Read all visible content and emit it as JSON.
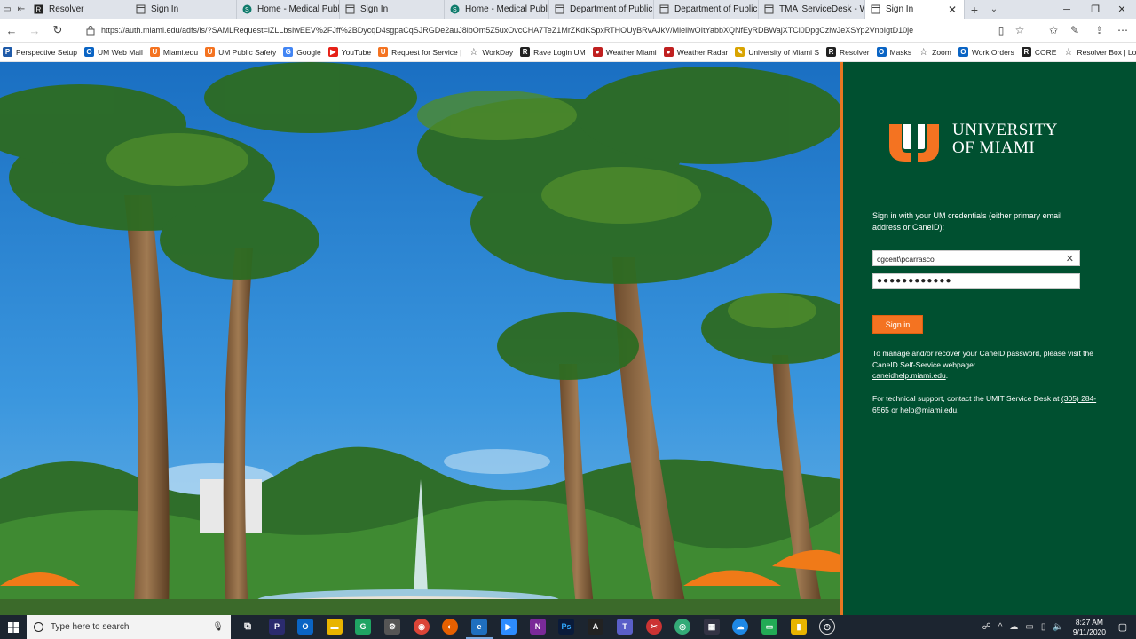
{
  "browser": {
    "tabs": [
      {
        "label": "Resolver",
        "icon": "resolver-icon",
        "active": false
      },
      {
        "label": "Sign In",
        "icon": "page-icon",
        "active": false
      },
      {
        "label": "Home - Medical Public",
        "icon": "sharepoint-icon",
        "active": false
      },
      {
        "label": "Sign In",
        "icon": "page-icon",
        "active": false
      },
      {
        "label": "Home - Medical Public",
        "icon": "sharepoint-icon",
        "active": false
      },
      {
        "label": "Department of Public S",
        "icon": "page-icon",
        "active": false
      },
      {
        "label": "Department of Public S",
        "icon": "page-icon",
        "active": false
      },
      {
        "label": "TMA iServiceDesk - Wo",
        "icon": "page-icon",
        "active": false
      },
      {
        "label": "Sign In",
        "icon": "page-icon",
        "active": true
      }
    ],
    "url": "https://auth.miami.edu/adfs/ls/?SAMLRequest=lZLLbsIwEEV%2FJff%2BDycqD4sgpaCqSJRGDe2auJ8ibOm5Z5uxOvcCHA7TeZ1MrZKdKSpxRTHOUyBRvAJkV/MieliwOItYabbXQNfEyRDBWajXTCl0DpgCzlwJeXSYp2VnbIgtD10je",
    "bookmarks": [
      {
        "label": "Perspective Setup",
        "icon": "perspective-icon",
        "color": "#1e5aa8"
      },
      {
        "label": "UM Web Mail",
        "icon": "outlook-icon",
        "color": "#0a64c4"
      },
      {
        "label": "Miami.edu",
        "icon": "um-icon",
        "color": "#f47321"
      },
      {
        "label": "UM Public Safety",
        "icon": "um-icon",
        "color": "#f47321"
      },
      {
        "label": "Google",
        "icon": "google-icon",
        "color": "#4285f4"
      },
      {
        "label": "YouTube",
        "icon": "youtube-icon",
        "color": "#e62117"
      },
      {
        "label": "Request for Service |",
        "icon": "um-icon",
        "color": "#f47321"
      },
      {
        "label": "WorkDay",
        "icon": "star-icon",
        "color": ""
      },
      {
        "label": "Rave Login UM",
        "icon": "rave-icon",
        "color": "#222222"
      },
      {
        "label": "Weather Miami",
        "icon": "weather-icon",
        "color": "#c02020"
      },
      {
        "label": "Weather Radar",
        "icon": "weather-icon",
        "color": "#c02020"
      },
      {
        "label": "University of Miami S",
        "icon": "pen-icon",
        "color": "#d9a400"
      },
      {
        "label": "Resolver",
        "icon": "resolver-icon",
        "color": "#222222"
      },
      {
        "label": "Masks",
        "icon": "outlook-icon",
        "color": "#0a64c4"
      },
      {
        "label": "Zoom",
        "icon": "star-icon",
        "color": ""
      },
      {
        "label": "Work Orders",
        "icon": "outlook-icon",
        "color": "#0a64c4"
      },
      {
        "label": "CORE",
        "icon": "resolver-icon",
        "color": "#222222"
      },
      {
        "label": "Resolver Box | Login",
        "icon": "star-icon",
        "color": ""
      }
    ]
  },
  "signin": {
    "logo_line1": "UNIVERSITY",
    "logo_line2": "OF MIAMI",
    "prompt": "Sign in with your UM credentials (either primary email address or CaneID):",
    "username_value": "cgcent\\pcarrasco",
    "password_mask": "●●●●●●●●●●●●",
    "button_label": "Sign in",
    "manage_text": "To manage and/or recover your CaneID password, please visit the CaneID Self-Service webpage:",
    "manage_link": "caneidhelp.miami.edu",
    "support_text": "For technical support, contact the UMIT Service Desk at",
    "support_phone": "(305) 284-6565",
    "support_or": "or",
    "support_email": "help@miami.edu",
    "support_end": ".",
    "colors": {
      "panel": "#005030",
      "accent": "#f47321"
    }
  },
  "taskbar": {
    "search_placeholder": "Type here to search",
    "time": "8:27 AM",
    "date": "9/11/2020"
  }
}
